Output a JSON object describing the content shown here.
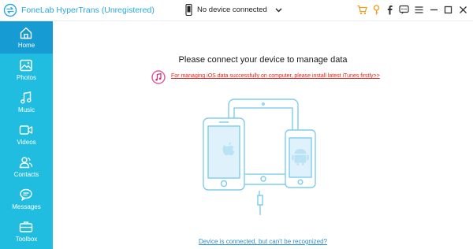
{
  "app": {
    "title": "FoneLab HyperTrans (Unregistered)"
  },
  "device": {
    "selected": "No device connected"
  },
  "sidebar": {
    "items": [
      {
        "label": "Home",
        "icon": "home-icon"
      },
      {
        "label": "Photos",
        "icon": "photo-icon"
      },
      {
        "label": "Music",
        "icon": "music-icon"
      },
      {
        "label": "Videos",
        "icon": "video-icon"
      },
      {
        "label": "Contacts",
        "icon": "contacts-icon"
      },
      {
        "label": "Messages",
        "icon": "messages-icon"
      },
      {
        "label": "Toolbox",
        "icon": "toolbox-icon"
      }
    ],
    "active_index": 0
  },
  "main": {
    "heading": "Please connect your device to manage data",
    "itunes_notice": "For managing iOS data successfully on computer, please install latest iTunes firstly>>",
    "bottom_link": "Device is connected, but can't be recognized?"
  },
  "colors": {
    "sidebar": "#21bde0",
    "sidebar_active": "#169bd2",
    "accent_orange": "#f39a1e",
    "link_red": "#e0241b",
    "link_blue": "#2b8fd0",
    "illustration": "#7fcdec"
  }
}
